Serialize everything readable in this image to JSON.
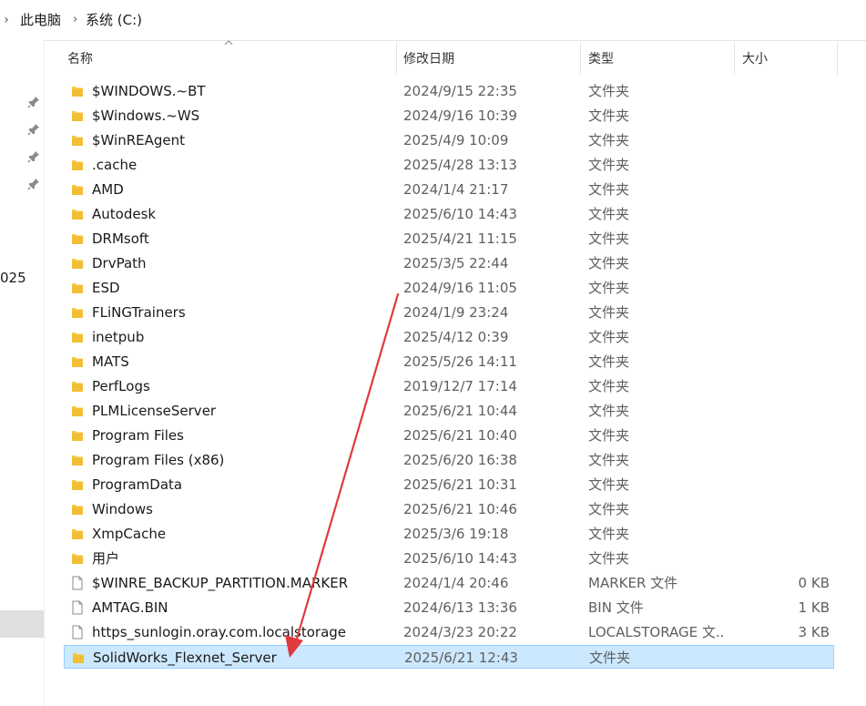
{
  "addressbar": {
    "crumbs": [
      "此电脑",
      "系统 (C:)"
    ]
  },
  "nav": {
    "partial_text": "025"
  },
  "columns": {
    "name": "名称",
    "date": "修改日期",
    "type": "类型",
    "size": "大小"
  },
  "rows": [
    {
      "name": "$WINDOWS.~BT",
      "date": "2024/9/15 22:35",
      "type": "文件夹",
      "size": "",
      "kind": "folder"
    },
    {
      "name": "$Windows.~WS",
      "date": "2024/9/16 10:39",
      "type": "文件夹",
      "size": "",
      "kind": "folder"
    },
    {
      "name": "$WinREAgent",
      "date": "2025/4/9 10:09",
      "type": "文件夹",
      "size": "",
      "kind": "folder"
    },
    {
      "name": ".cache",
      "date": "2025/4/28 13:13",
      "type": "文件夹",
      "size": "",
      "kind": "folder"
    },
    {
      "name": "AMD",
      "date": "2024/1/4 21:17",
      "type": "文件夹",
      "size": "",
      "kind": "folder"
    },
    {
      "name": "Autodesk",
      "date": "2025/6/10 14:43",
      "type": "文件夹",
      "size": "",
      "kind": "folder"
    },
    {
      "name": "DRMsoft",
      "date": "2025/4/21 11:15",
      "type": "文件夹",
      "size": "",
      "kind": "folder"
    },
    {
      "name": "DrvPath",
      "date": "2025/3/5 22:44",
      "type": "文件夹",
      "size": "",
      "kind": "folder"
    },
    {
      "name": "ESD",
      "date": "2024/9/16 11:05",
      "type": "文件夹",
      "size": "",
      "kind": "folder"
    },
    {
      "name": "FLiNGTrainers",
      "date": "2024/1/9 23:24",
      "type": "文件夹",
      "size": "",
      "kind": "folder"
    },
    {
      "name": "inetpub",
      "date": "2025/4/12 0:39",
      "type": "文件夹",
      "size": "",
      "kind": "folder"
    },
    {
      "name": "MATS",
      "date": "2025/5/26 14:11",
      "type": "文件夹",
      "size": "",
      "kind": "folder"
    },
    {
      "name": "PerfLogs",
      "date": "2019/12/7 17:14",
      "type": "文件夹",
      "size": "",
      "kind": "folder"
    },
    {
      "name": "PLMLicenseServer",
      "date": "2025/6/21 10:44",
      "type": "文件夹",
      "size": "",
      "kind": "folder"
    },
    {
      "name": "Program Files",
      "date": "2025/6/21 10:40",
      "type": "文件夹",
      "size": "",
      "kind": "folder"
    },
    {
      "name": "Program Files (x86)",
      "date": "2025/6/20 16:38",
      "type": "文件夹",
      "size": "",
      "kind": "folder"
    },
    {
      "name": "ProgramData",
      "date": "2025/6/21 10:31",
      "type": "文件夹",
      "size": "",
      "kind": "folder"
    },
    {
      "name": "Windows",
      "date": "2025/6/21 10:46",
      "type": "文件夹",
      "size": "",
      "kind": "folder"
    },
    {
      "name": "XmpCache",
      "date": "2025/3/6 19:18",
      "type": "文件夹",
      "size": "",
      "kind": "folder"
    },
    {
      "name": "用户",
      "date": "2025/6/10 14:43",
      "type": "文件夹",
      "size": "",
      "kind": "folder"
    },
    {
      "name": "$WINRE_BACKUP_PARTITION.MARKER",
      "date": "2024/1/4 20:46",
      "type": "MARKER 文件",
      "size": "0 KB",
      "kind": "file"
    },
    {
      "name": "AMTAG.BIN",
      "date": "2024/6/13 13:36",
      "type": "BIN 文件",
      "size": "1 KB",
      "kind": "file"
    },
    {
      "name": "https_sunlogin.oray.com.localstorage",
      "date": "2024/3/23 20:22",
      "type": "LOCALSTORAGE 文...",
      "size": "3 KB",
      "kind": "file"
    },
    {
      "name": "SolidWorks_Flexnet_Server",
      "date": "2025/6/21 12:43",
      "type": "文件夹",
      "size": "",
      "kind": "folder",
      "selected": true
    }
  ],
  "colors": {
    "folder": "#f8c945",
    "folder_dark": "#e6a817",
    "selection_bg": "#cce8ff",
    "selection_border": "#99d1ff",
    "annotation_arrow": "#e0393e"
  }
}
